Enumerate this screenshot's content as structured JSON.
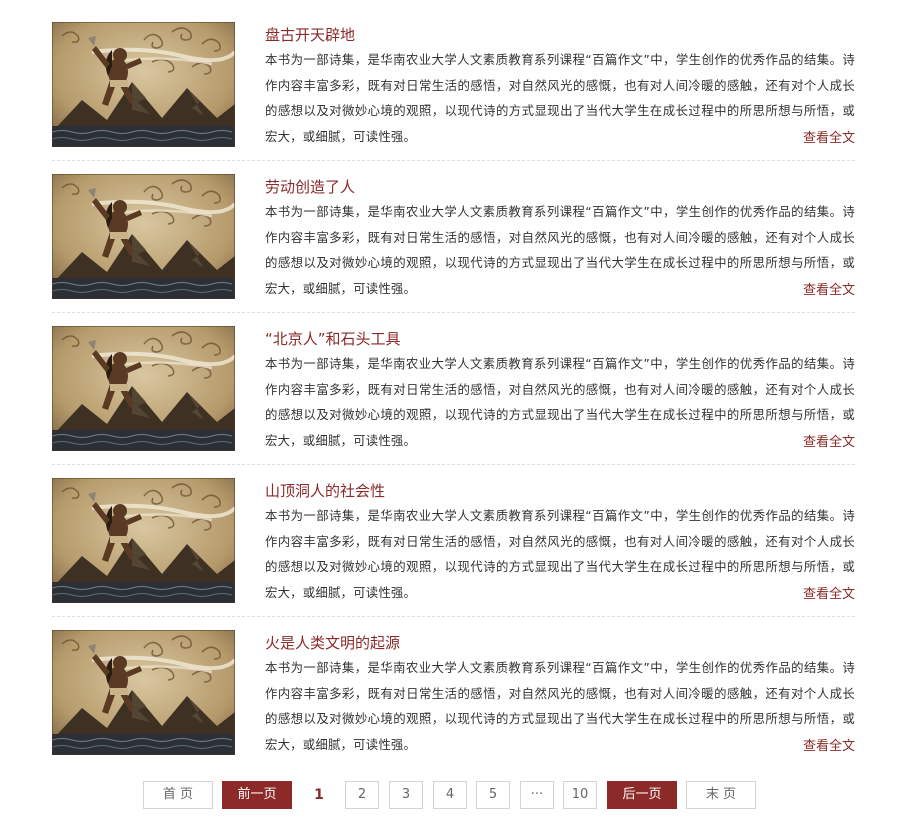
{
  "items": [
    {
      "title": "盘古开天辟地",
      "desc": "本书为一部诗集，是华南农业大学人文素质教育系列课程“百篇作文”中，学生创作的优秀作品的结集。诗作内容丰富多彩，既有对日常生活的感悟，对自然风光的感慨，也有对人间冷暖的感触，还有对个人成长的感想以及对微妙心境的观照，以现代诗的方式显现出了当代大学生在成长过程中的所思所想与所悟，或宏大，或细腻，可读性强。",
      "more": "查看全文"
    },
    {
      "title": "劳动创造了人",
      "desc": "本书为一部诗集，是华南农业大学人文素质教育系列课程“百篇作文”中，学生创作的优秀作品的结集。诗作内容丰富多彩，既有对日常生活的感悟，对自然风光的感慨，也有对人间冷暖的感触，还有对个人成长的感想以及对微妙心境的观照，以现代诗的方式显现出了当代大学生在成长过程中的所思所想与所悟，或宏大，或细腻，可读性强。",
      "more": "查看全文"
    },
    {
      "title": "“北京人”和石头工具",
      "desc": "本书为一部诗集，是华南农业大学人文素质教育系列课程“百篇作文”中，学生创作的优秀作品的结集。诗作内容丰富多彩，既有对日常生活的感悟，对自然风光的感慨，也有对人间冷暖的感触，还有对个人成长的感想以及对微妙心境的观照，以现代诗的方式显现出了当代大学生在成长过程中的所思所想与所悟，或宏大，或细腻，可读性强。",
      "more": "查看全文"
    },
    {
      "title": "山顶洞人的社会性",
      "desc": "本书为一部诗集，是华南农业大学人文素质教育系列课程“百篇作文”中，学生创作的优秀作品的结集。诗作内容丰富多彩，既有对日常生活的感悟，对自然风光的感慨，也有对人间冷暖的感触，还有对个人成长的感想以及对微妙心境的观照，以现代诗的方式显现出了当代大学生在成长过程中的所思所想与所悟，或宏大，或细腻，可读性强。",
      "more": "查看全文"
    },
    {
      "title": "火是人类文明的起源",
      "desc": "本书为一部诗集，是华南农业大学人文素质教育系列课程“百篇作文”中，学生创作的优秀作品的结集。诗作内容丰富多彩，既有对日常生活的感悟，对自然风光的感慨，也有对人间冷暖的感触，还有对个人成长的感想以及对微妙心境的观照，以现代诗的方式显现出了当代大学生在成长过程中的所思所想与所悟，或宏大，或细腻，可读性强。",
      "more": "查看全文"
    }
  ],
  "pagination": {
    "first": "首 页",
    "prev": "前一页",
    "pages": [
      "1",
      "2",
      "3",
      "4",
      "5",
      "···",
      "10"
    ],
    "current": "1",
    "next": "后一页",
    "last": "末 页"
  },
  "colors": {
    "accent": "#8b2a28",
    "title": "#8a2a2a",
    "border": "#d4d4d4"
  }
}
